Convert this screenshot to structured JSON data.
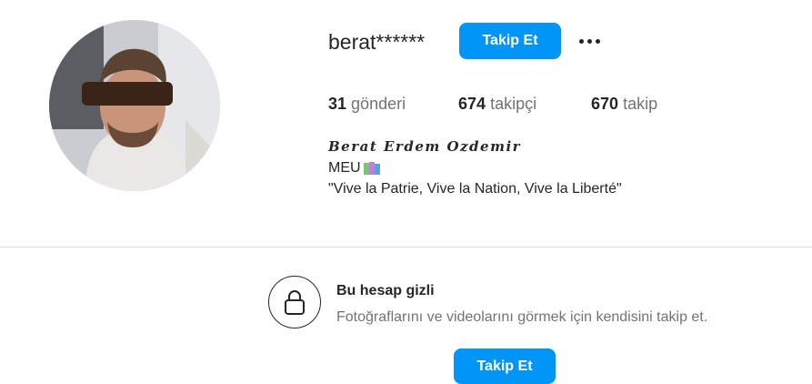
{
  "profile": {
    "username": "berat******",
    "follow_label": "Takip Et",
    "more_icon": "more-horizontal-icon",
    "avatar": "profile-photo",
    "stats": [
      {
        "value": "31",
        "label": "gönderi"
      },
      {
        "value": "674",
        "label": "takipçi"
      },
      {
        "value": "670",
        "label": "takip"
      }
    ],
    "full_name": "Berat Erdem Ozdemir",
    "bio_line1": "MEU",
    "bio_line1_icon": "books-emoji",
    "bio_line2": "\"Vive la Patrie, Vive la Nation, Vive la Liberté\""
  },
  "private_notice": {
    "icon": "lock-icon",
    "title": "Bu hesap gizli",
    "description": "Fotoğraflarını ve videolarını görmek için kendisini takip et.",
    "follow_label": "Takip Et"
  },
  "colors": {
    "accent": "#0095f6",
    "text": "#262626",
    "muted": "#737373",
    "divider": "#dbdbdb"
  }
}
